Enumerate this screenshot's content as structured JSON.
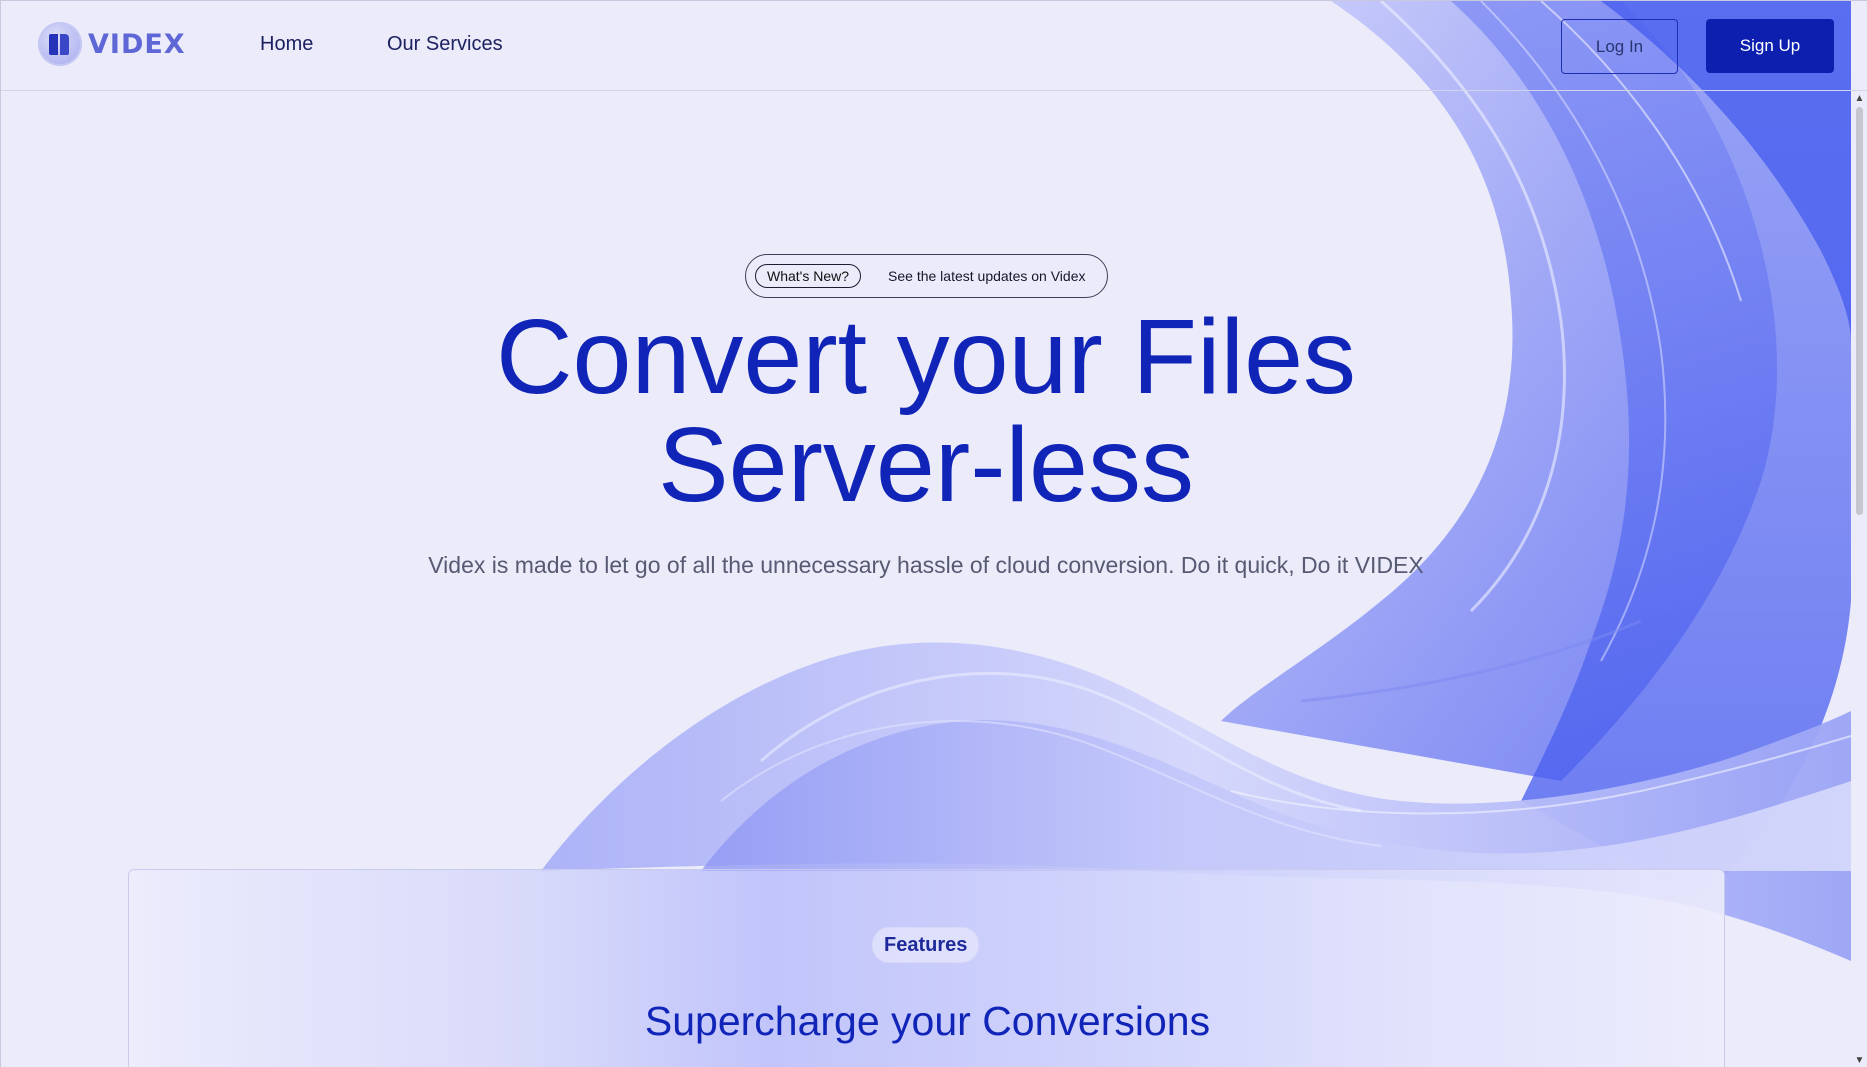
{
  "header": {
    "logo_text": "VIDEX",
    "nav": [
      {
        "label": "Home"
      },
      {
        "label": "Our Services"
      }
    ],
    "login_label": "Log In",
    "signup_label": "Sign Up"
  },
  "hero": {
    "pill_tag": "What's New?",
    "pill_text": "See the latest updates on Videx",
    "title_line1": "Convert your Files",
    "title_line2": "Server-less",
    "subtitle": "Videx is made to let go of all the unnecessary hassle of cloud conversion. Do it quick, Do it VIDEX"
  },
  "features": {
    "badge": "Features",
    "title": "Supercharge your Conversions"
  },
  "colors": {
    "accent": "#1024b8",
    "button_primary": "#0c1fae",
    "background": "#ebebfa"
  },
  "icons": {
    "logo": "videx-logo-icon",
    "scroll_up": "chevron-up-icon",
    "scroll_down": "chevron-down-icon"
  }
}
